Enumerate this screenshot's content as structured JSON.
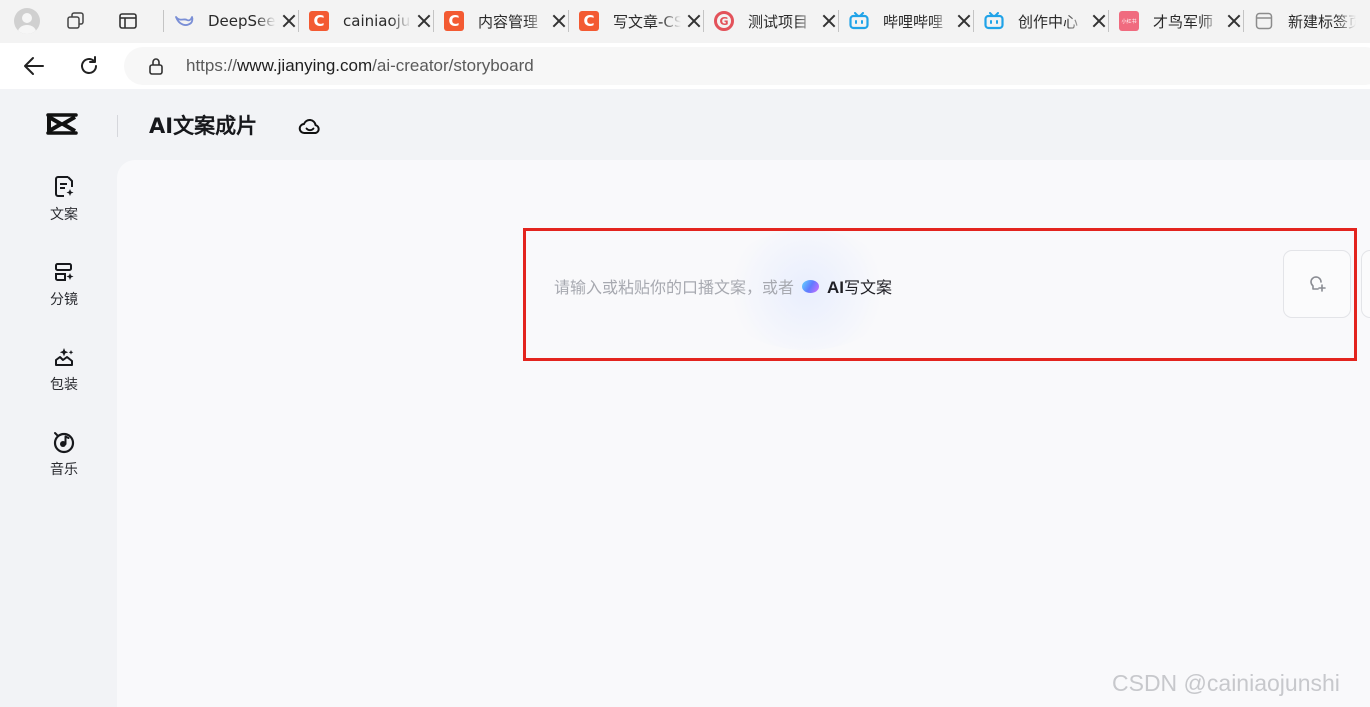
{
  "browser": {
    "tabs": [
      {
        "title": "DeepSeek",
        "icon": "deepseek-whale-icon",
        "color": "#7a8fd6",
        "glyph": ""
      },
      {
        "title": "cainiaojunshi",
        "icon": "csdn-icon",
        "color": "#f35a32",
        "glyph": "C"
      },
      {
        "title": "内容管理",
        "icon": "csdn-icon",
        "color": "#f35a32",
        "glyph": "C"
      },
      {
        "title": "写文章-CSDN",
        "icon": "csdn-icon",
        "color": "#f35a32",
        "glyph": "C"
      },
      {
        "title": "测试项目",
        "icon": "g-ring-icon",
        "color": "#e3525a",
        "glyph": "G"
      },
      {
        "title": "哔哩哔哩",
        "icon": "bilibili-icon",
        "color": "#20a3e8",
        "glyph": ""
      },
      {
        "title": "创作中心",
        "icon": "bilibili-icon",
        "color": "#20a3e8",
        "glyph": ""
      },
      {
        "title": "才鸟军师",
        "icon": "xiaohongshu-icon",
        "color": "#f06b7f",
        "glyph": "小红书"
      },
      {
        "title": "新建标签页",
        "icon": "new-tab-page-icon",
        "color": "#8c8c8c",
        "glyph": ""
      }
    ],
    "url_scheme": "https://",
    "url_host": "www.jianying.com",
    "url_path": "/ai-creator/storyboard"
  },
  "app": {
    "title": "AI文案成片",
    "sidebar": [
      {
        "label": "文案",
        "icon": "script-icon"
      },
      {
        "label": "分镜",
        "icon": "storyboard-icon"
      },
      {
        "label": "包装",
        "icon": "packaging-icon"
      },
      {
        "label": "音乐",
        "icon": "music-icon"
      }
    ],
    "prompt": {
      "placeholder": "请输入或粘贴你的口播文案，或者",
      "ai_prefix": "AI",
      "ai_suffix": "写文案"
    }
  },
  "watermark": "CSDN @cainiaojunshi",
  "colors": {
    "highlight": "#e3241e",
    "canvas": "#f9f9fb",
    "sidebar_bg": "#f2f3f6"
  }
}
